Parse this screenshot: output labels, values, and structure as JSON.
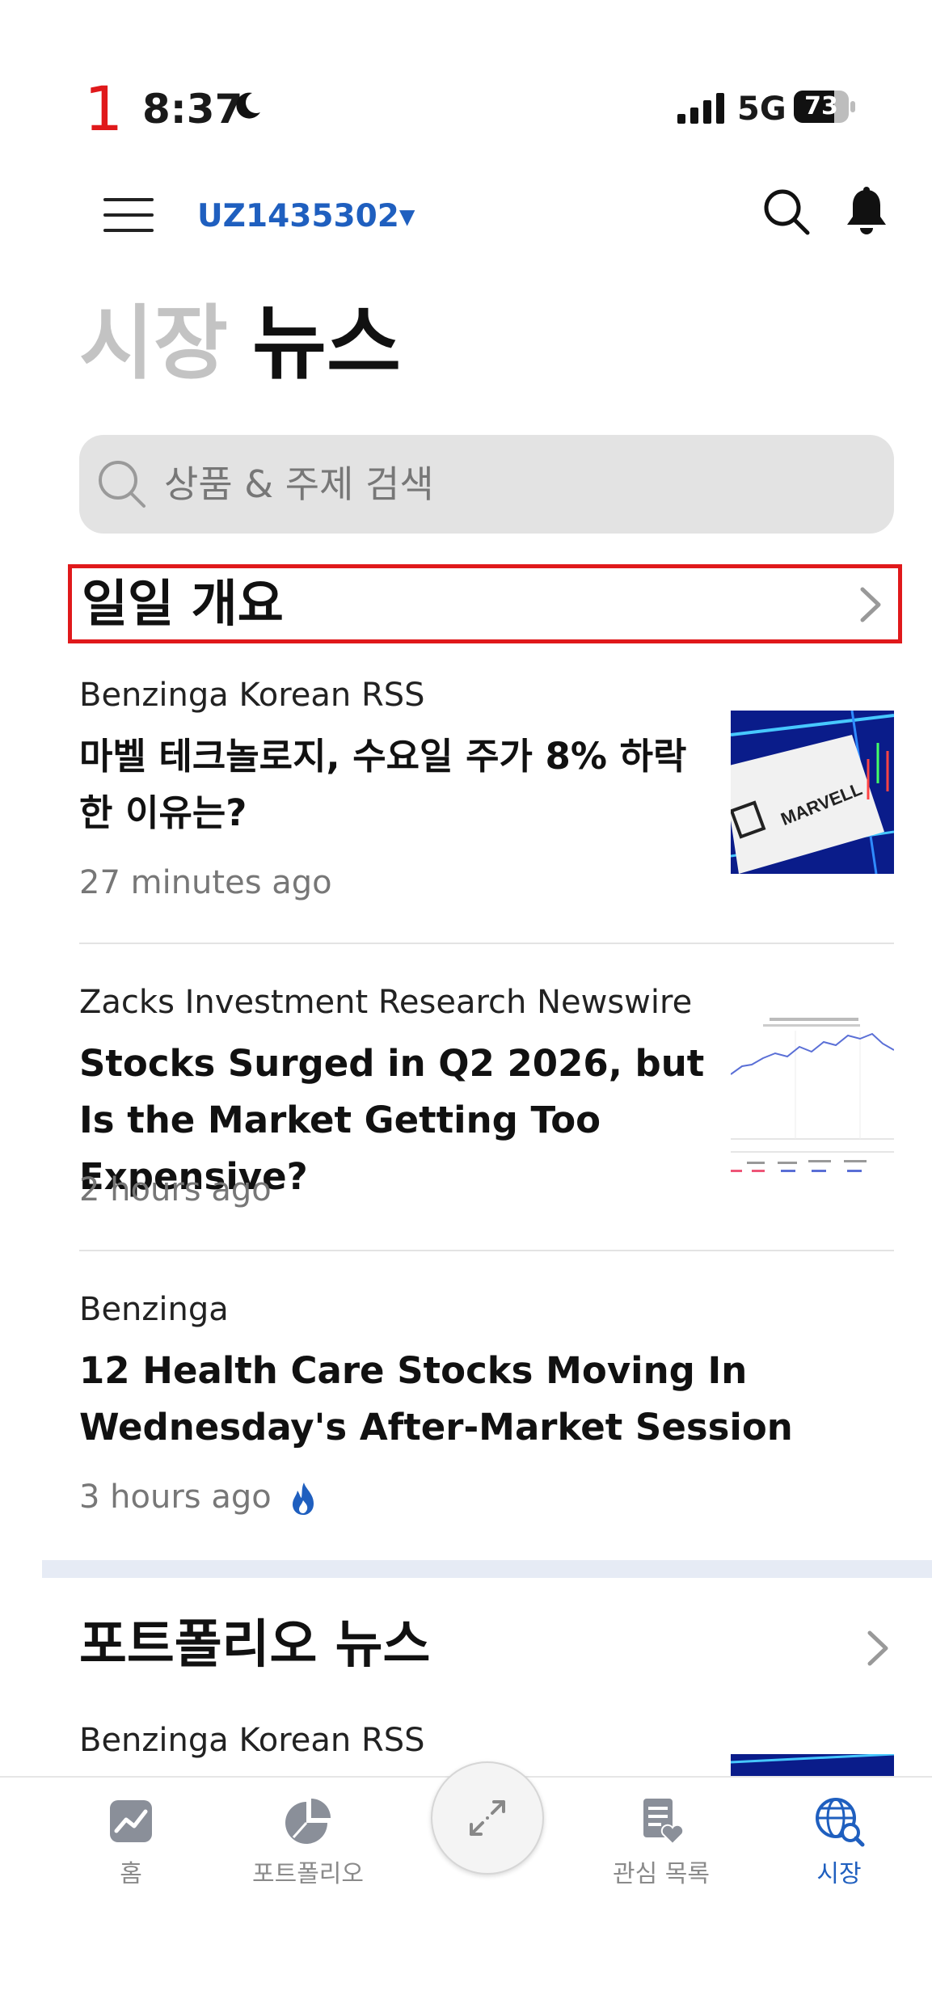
{
  "status_bar": {
    "marker": "1",
    "time": "8:37",
    "network": "5G",
    "battery": "73",
    "battery_level": 0.73
  },
  "header": {
    "account": "UZ1435302▾",
    "icons": [
      "menu-icon",
      "search-icon",
      "bell-icon"
    ]
  },
  "title": {
    "inactive": "시장",
    "active": "뉴스"
  },
  "search": {
    "placeholder": "상품 & 주제 검색"
  },
  "daily_section": {
    "label": "일일 개요"
  },
  "articles": [
    {
      "source": "Benzinga Korean RSS",
      "headline": "마벨 테크놀로지, 수요일 주가 8% 하락한 이유는?",
      "time": "27 minutes ago",
      "thumb_text": "MARVELL"
    },
    {
      "source": "Zacks Investment Research Newswire",
      "headline": "Stocks Surged in Q2 2026, but Is the Market Getting Too Expensive?",
      "time": "2 hours ago"
    },
    {
      "source": "Benzinga",
      "headline": "12 Health Care Stocks Moving In Wednesday's After-Market Session",
      "time": "3 hours ago",
      "trending": true
    }
  ],
  "portfolio_section": {
    "label": "포트폴리오 뉴스",
    "first_source": "Benzinga Korean RSS"
  },
  "tabbar": {
    "tabs": [
      {
        "label": "홈",
        "icon": "home-chart-icon"
      },
      {
        "label": "포트폴리오",
        "icon": "pie-chart-icon"
      },
      {
        "label": "관심 목록",
        "icon": "watchlist-icon"
      },
      {
        "label": "시장",
        "icon": "globe-search-icon",
        "active": true
      }
    ],
    "center_icon": "expand-arrows-icon"
  },
  "colors": {
    "accent": "#1f5fbf",
    "highlight": "#e0191b",
    "muted": "#c3c3c3"
  }
}
